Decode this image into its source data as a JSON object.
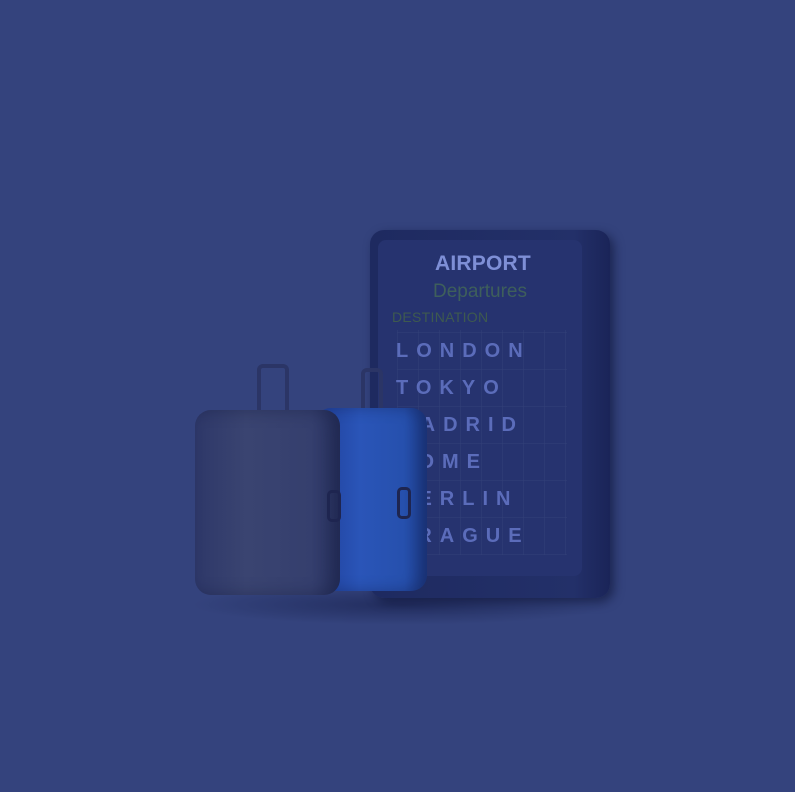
{
  "scene": {
    "background_color": "#34437d",
    "description_icons": [
      "suitcase-grey-icon",
      "suitcase-blue-icon",
      "departures-board-icon"
    ]
  },
  "board": {
    "title": "AIRPORT",
    "subtitle": "Departures",
    "column_header": "DESTINATION",
    "cities": [
      "LONDON",
      "TOKYO",
      "MADRID",
      "ROME",
      "BERLIN",
      "PRAGUE"
    ]
  }
}
